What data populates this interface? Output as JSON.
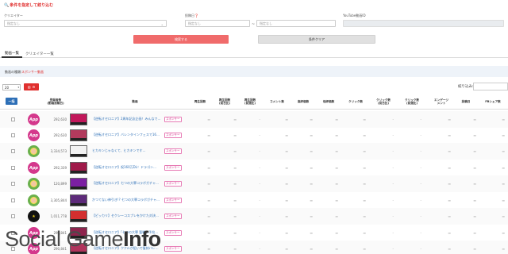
{
  "filter": {
    "title": "条件を指定して絞り込む",
    "creator_label": "クリエイター",
    "creator_value": "指定なし",
    "date_label": "投稿日",
    "date_from": "指定なし",
    "date_to": "指定なし",
    "video_id_label": "YouTube動画ID",
    "search_button": "検索する",
    "clear_button": "条件クリア"
  },
  "tabs": [
    "動画一覧",
    "クリエイター一覧"
  ],
  "info": {
    "label": "動画の種類:",
    "value": "スポンサー動画"
  },
  "per_page": "20",
  "narrow_label": "絞り込み:",
  "bulk_label": "一括",
  "headers": {
    "subscribers": "登録者数\n(動画投稿日)",
    "video": "動画",
    "views": "再生回数",
    "views_1d": "再生回数\n(前日比)",
    "views_7d": "再生回数\n(前週比)",
    "comments": "コメント数",
    "likes": "高評価数",
    "dislikes": "低評価数",
    "clicks": "クリック数",
    "clicks_1d": "クリック数\n(前日比)",
    "clicks_7d": "クリック数\n(前週比)",
    "engagement": "エンゲージ\nメント",
    "post_date": "投稿日",
    "fb_shares": "FBシェア数"
  },
  "rows": [
    {
      "avatar": "App",
      "subscribers": "292,630",
      "title": "【逆転オセロニア】2周年記念企画！みんなで…",
      "badge": "スポンサー",
      "thumb": "#c2185b"
    },
    {
      "avatar": "App",
      "subscribers": "292,630",
      "title": "【逆転オセロニア】バレンタインフェスで16…",
      "badge": "スポンサー",
      "thumb": "#b23a5d"
    },
    {
      "avatar": "face",
      "subscribers": "3,334,573",
      "title": "ヒカキンじゃなくて、ヒカキンです…",
      "badge": "スポンサー",
      "thumb": "#f2f2f2"
    },
    {
      "avatar": "App",
      "subscribers": "292,339",
      "title": "【逆転オセロニア】祝160万DL！ドラゴン…",
      "badge": "スポンサー",
      "thumb": "#a01a4a"
    },
    {
      "avatar": "face",
      "subscribers": "120,899",
      "title": "【逆転オセロニア】七つの大罪コラボガチャ…",
      "badge": "スポンサー",
      "thumb": "#7b1fa2"
    },
    {
      "avatar": "face",
      "subscribers": "3,305,844",
      "title": "かつてない神引き!? 七つの大罪コラボガチャ…",
      "badge": "スポンサー",
      "thumb": "#5d2a7a"
    },
    {
      "avatar": "dark",
      "subscribers": "1,011,778",
      "title": "【ピッカリ】セクシーコスプレをかけた対決…",
      "badge": "スポンサー",
      "thumb": "#d32f2f"
    },
    {
      "avatar": "App",
      "subscribers": "290,841",
      "title": "【逆転オセロニア】「七つの大罪 聖戦の予兆…",
      "badge": "スポンサー",
      "thumb": "#8e244d"
    },
    {
      "avatar": "App",
      "subscribers": "290,841",
      "title": "【逆転オセロニア】ククルが狙いで復刻バレ…",
      "badge": "スポンサー",
      "thumb": "#b0345c"
    }
  ],
  "watermark": {
    "light": "Social Game",
    "bold": "Info"
  }
}
